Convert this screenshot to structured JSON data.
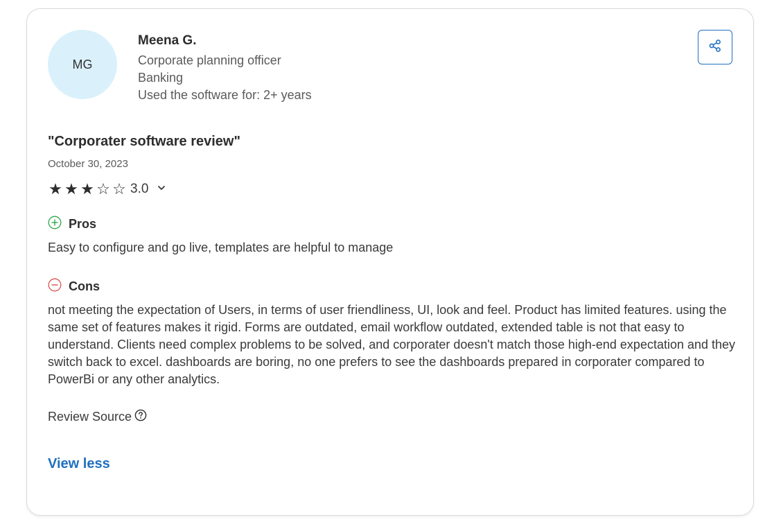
{
  "reviewer": {
    "initials": "MG",
    "name": "Meena G.",
    "job_title": "Corporate planning officer",
    "industry": "Banking",
    "usage": "Used the software for: 2+ years"
  },
  "review": {
    "title": "\"Corporater software review\"",
    "date": "October 30, 2023",
    "rating": {
      "value_label": "3.0",
      "value": 3,
      "max": 5
    },
    "pros": {
      "label": "Pros",
      "text": "Easy to configure and go live, templates are helpful to manage"
    },
    "cons": {
      "label": "Cons",
      "text": "not meeting the expectation of Users, in terms of user friendliness, UI, look and feel. Product has limited features. using the same set of features makes it rigid. Forms are outdated, email workflow outdated, extended table is not that easy to understand. Clients need complex problems to be solved, and corporater doesn't match those high-end expectation and they switch back to excel. dashboards are boring, no one prefers to see the dashboards prepared in corporater compared to PowerBi or any other analytics."
    },
    "source_label": "Review Source"
  },
  "actions": {
    "view_less_label": "View less"
  },
  "icons": {
    "share": "share-icon",
    "pros": "plus-circle-icon",
    "cons": "minus-circle-icon",
    "help": "question-circle-icon",
    "chevron": "chevron-down-icon"
  },
  "colors": {
    "avatar_bg": "#daf1fb",
    "link": "#1f6fbf",
    "pros": "#2ea84a",
    "cons": "#d9534f"
  }
}
